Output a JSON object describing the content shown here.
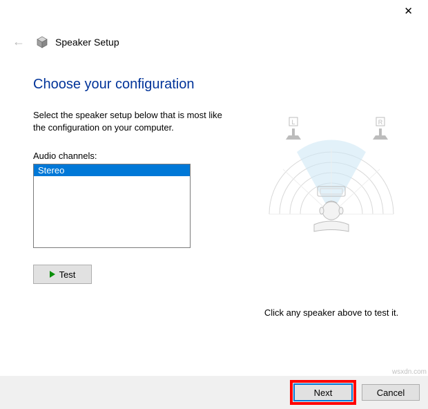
{
  "titlebar": {
    "close": "✕"
  },
  "header": {
    "title": "Speaker Setup"
  },
  "page": {
    "heading": "Choose your configuration",
    "instructions": "Select the speaker setup below that is most like the configuration on your computer.",
    "channels_label": "Audio channels:",
    "channels": [
      "Stereo"
    ],
    "selected_channel": "Stereo",
    "test_label": "Test",
    "diagram_hint": "Click any speaker above to test it.",
    "speaker_left": "L",
    "speaker_right": "R"
  },
  "buttons": {
    "next": "Next",
    "cancel": "Cancel"
  },
  "watermark": "wsxdn.com"
}
